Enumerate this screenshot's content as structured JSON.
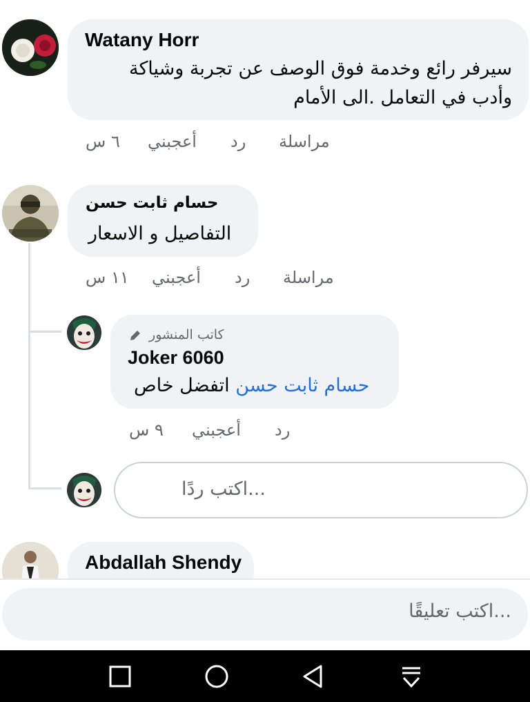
{
  "comments": [
    {
      "author": "Watany Horr",
      "lines": [
        "سيرفر رائع وخدمة فوق الوصف عن تجربة وشياكة",
        "وأدب في التعامل .الى الأمام"
      ],
      "actions": {
        "message": "مراسلة",
        "reply": "رد",
        "like": "أعجبني",
        "time": "٦ س"
      }
    },
    {
      "author": "حسام ثابت حسن",
      "lines": [
        "التفاصيل و الاسعار"
      ],
      "actions": {
        "message": "مراسلة",
        "reply": "رد",
        "like": "أعجبني",
        "time": "١١ س"
      }
    },
    {
      "author": "Abdallah Shendy"
    }
  ],
  "reply": {
    "badge": "كاتب المنشور",
    "author": "Joker 6060",
    "mention": "حسام ثابت حسن",
    "text": "اتفضل خاص",
    "actions": {
      "reply": "رد",
      "like": "أعجبني",
      "time": "٩ س"
    }
  },
  "reply_input": {
    "placeholder": "اكتب ردًا..."
  },
  "composer": {
    "placeholder": "اكتب تعليقًا..."
  },
  "icons": {
    "author_badge": "pencil-icon",
    "nav": [
      "recents-square-icon",
      "home-circle-icon",
      "back-triangle-icon",
      "notifications-pull-icon"
    ]
  },
  "colors": {
    "bubble": "#f0f2f5",
    "mention": "#216fdb",
    "secondary_text": "#65676b"
  }
}
